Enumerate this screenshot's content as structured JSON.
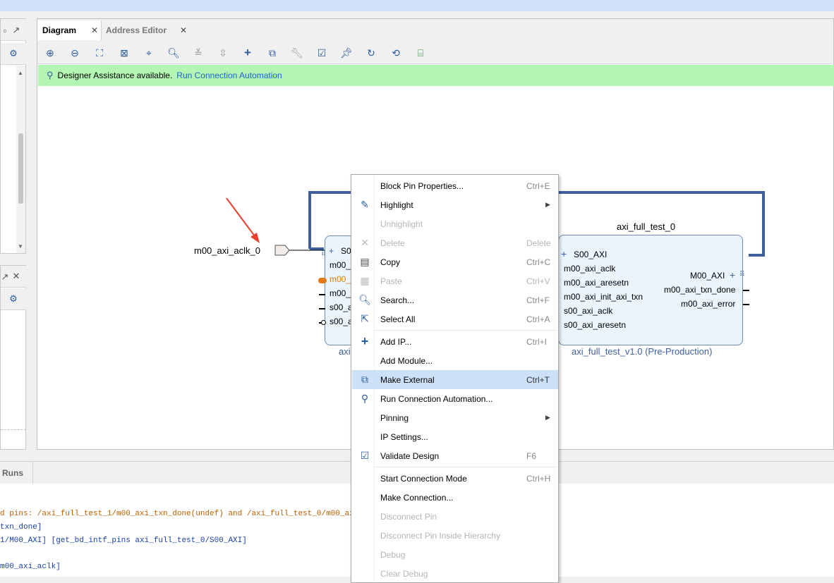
{
  "tabs": [
    {
      "label": "Diagram",
      "active": true
    },
    {
      "label": "Address Editor",
      "active": false
    }
  ],
  "assist": {
    "text": "Designer Assistance available.",
    "link": "Run Connection Automation"
  },
  "canvas": {
    "external_port": "m00_axi_aclk_0",
    "block0": {
      "pins_left_visible": [
        "S0",
        "m00_",
        "m00_",
        "m00_",
        "s00_a",
        "s00_a"
      ],
      "caption_visible": "axi"
    },
    "block1": {
      "title": "axi_full_test_0",
      "left_pins": [
        "S00_AXI",
        "m00_axi_aclk",
        "m00_axi_aresetn",
        "m00_axi_init_axi_txn",
        "s00_axi_aclk",
        "s00_axi_aresetn"
      ],
      "right_pins": [
        "M00_AXI",
        "m00_axi_txn_done",
        "m00_axi_error"
      ],
      "caption": "axi_full_test_v1.0 (Pre-Production)"
    }
  },
  "bottom": {
    "tab_label": "Runs",
    "console_lines": [
      "d pins: /axi_full_test_1/m00_axi_txn_done(undef) and /axi_full_test_0/m00_axi_aclk(",
      "txn_done]",
      "1/M00_AXI] [get_bd_intf_pins axi_full_test_0/S00_AXI]",
      "",
      "m00_axi_aclk]"
    ]
  },
  "context_menu": {
    "items": [
      {
        "label": "Block Pin Properties...",
        "shortcut": "Ctrl+E",
        "icon": "none",
        "enabled": true
      },
      {
        "label": "Highlight",
        "shortcut": "",
        "icon": "highlight-brush-icon",
        "enabled": true,
        "submenu": true
      },
      {
        "label": "Unhighlight",
        "shortcut": "",
        "icon": "none",
        "enabled": false
      },
      {
        "label": "Delete",
        "shortcut": "Delete",
        "icon": "delete-x-icon",
        "enabled": false
      },
      {
        "label": "Copy",
        "shortcut": "Ctrl+C",
        "icon": "copy-icon",
        "enabled": true
      },
      {
        "label": "Paste",
        "shortcut": "Ctrl+V",
        "icon": "paste-icon",
        "enabled": false
      },
      {
        "label": "Search...",
        "shortcut": "Ctrl+F",
        "icon": "search-icon",
        "enabled": true
      },
      {
        "label": "Select All",
        "shortcut": "Ctrl+A",
        "icon": "select-all-icon",
        "enabled": true
      },
      {
        "label": "Add IP...",
        "shortcut": "Ctrl+I",
        "icon": "plus-icon",
        "enabled": true
      },
      {
        "label": "Add Module...",
        "shortcut": "",
        "icon": "none",
        "enabled": true
      },
      {
        "label": "Make External",
        "shortcut": "Ctrl+T",
        "icon": "make-external-icon",
        "enabled": true,
        "selected": true
      },
      {
        "label": "Run Connection Automation...",
        "shortcut": "",
        "icon": "wand-icon",
        "enabled": true
      },
      {
        "label": "Pinning",
        "shortcut": "",
        "icon": "none",
        "enabled": true,
        "submenu": true
      },
      {
        "label": "IP Settings...",
        "shortcut": "",
        "icon": "none",
        "enabled": true
      },
      {
        "label": "Validate Design",
        "shortcut": "F6",
        "icon": "validate-check-icon",
        "enabled": true
      },
      {
        "label": "Start Connection Mode",
        "shortcut": "Ctrl+H",
        "icon": "none",
        "enabled": true
      },
      {
        "label": "Make Connection...",
        "shortcut": "",
        "icon": "none",
        "enabled": true
      },
      {
        "label": "Disconnect Pin",
        "shortcut": "",
        "icon": "none",
        "enabled": false
      },
      {
        "label": "Disconnect Pin Inside Hierarchy",
        "shortcut": "",
        "icon": "none",
        "enabled": false
      },
      {
        "label": "Debug",
        "shortcut": "",
        "icon": "none",
        "enabled": false
      },
      {
        "label": "Clear Debug",
        "shortcut": "",
        "icon": "none",
        "enabled": false
      }
    ]
  },
  "colors": {
    "accent_blue": "#2c5d9e",
    "wire_blue": "#3f5f9e",
    "assist_green": "#b3f5b3",
    "link_blue": "#1a66cc",
    "arrow_red": "#e8402e",
    "selected_pin_orange": "#e07a16",
    "menu_selected": "#cce0f7"
  }
}
